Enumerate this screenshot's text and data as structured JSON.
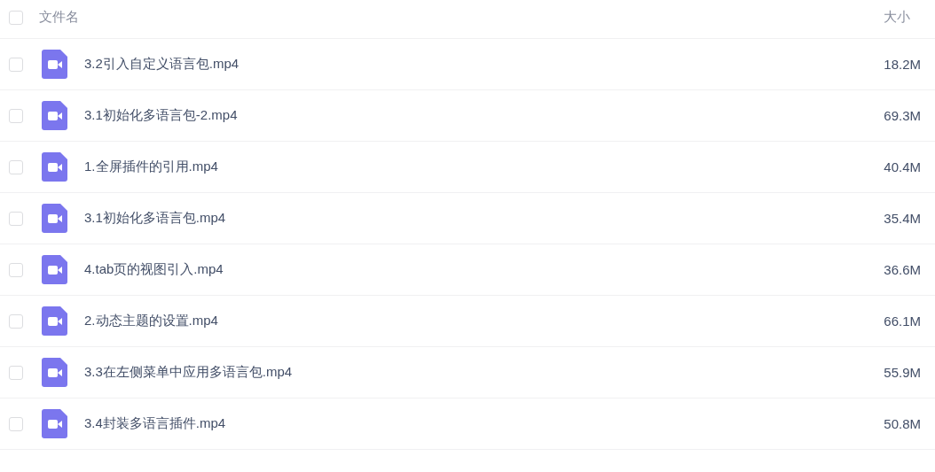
{
  "table": {
    "columns": [
      "文件名",
      "大小"
    ],
    "header_checked": false,
    "rows": [
      {
        "name": "3.2引入自定义语言包.mp4",
        "size": "18.2M",
        "checked": false,
        "kind": "video"
      },
      {
        "name": "3.1初始化多语言包-2.mp4",
        "size": "69.3M",
        "checked": false,
        "kind": "video"
      },
      {
        "name": "1.全屏插件的引用.mp4",
        "size": "40.4M",
        "checked": false,
        "kind": "video"
      },
      {
        "name": "3.1初始化多语言包.mp4",
        "size": "35.4M",
        "checked": false,
        "kind": "video"
      },
      {
        "name": "4.tab页的视图引入.mp4",
        "size": "36.6M",
        "checked": false,
        "kind": "video"
      },
      {
        "name": "2.动态主题的设置.mp4",
        "size": "66.1M",
        "checked": false,
        "kind": "video"
      },
      {
        "name": "3.3在左侧菜单中应用多语言包.mp4",
        "size": "55.9M",
        "checked": false,
        "kind": "video"
      },
      {
        "name": "3.4封装多语言插件.mp4",
        "size": "50.8M",
        "checked": false,
        "kind": "video"
      }
    ]
  }
}
